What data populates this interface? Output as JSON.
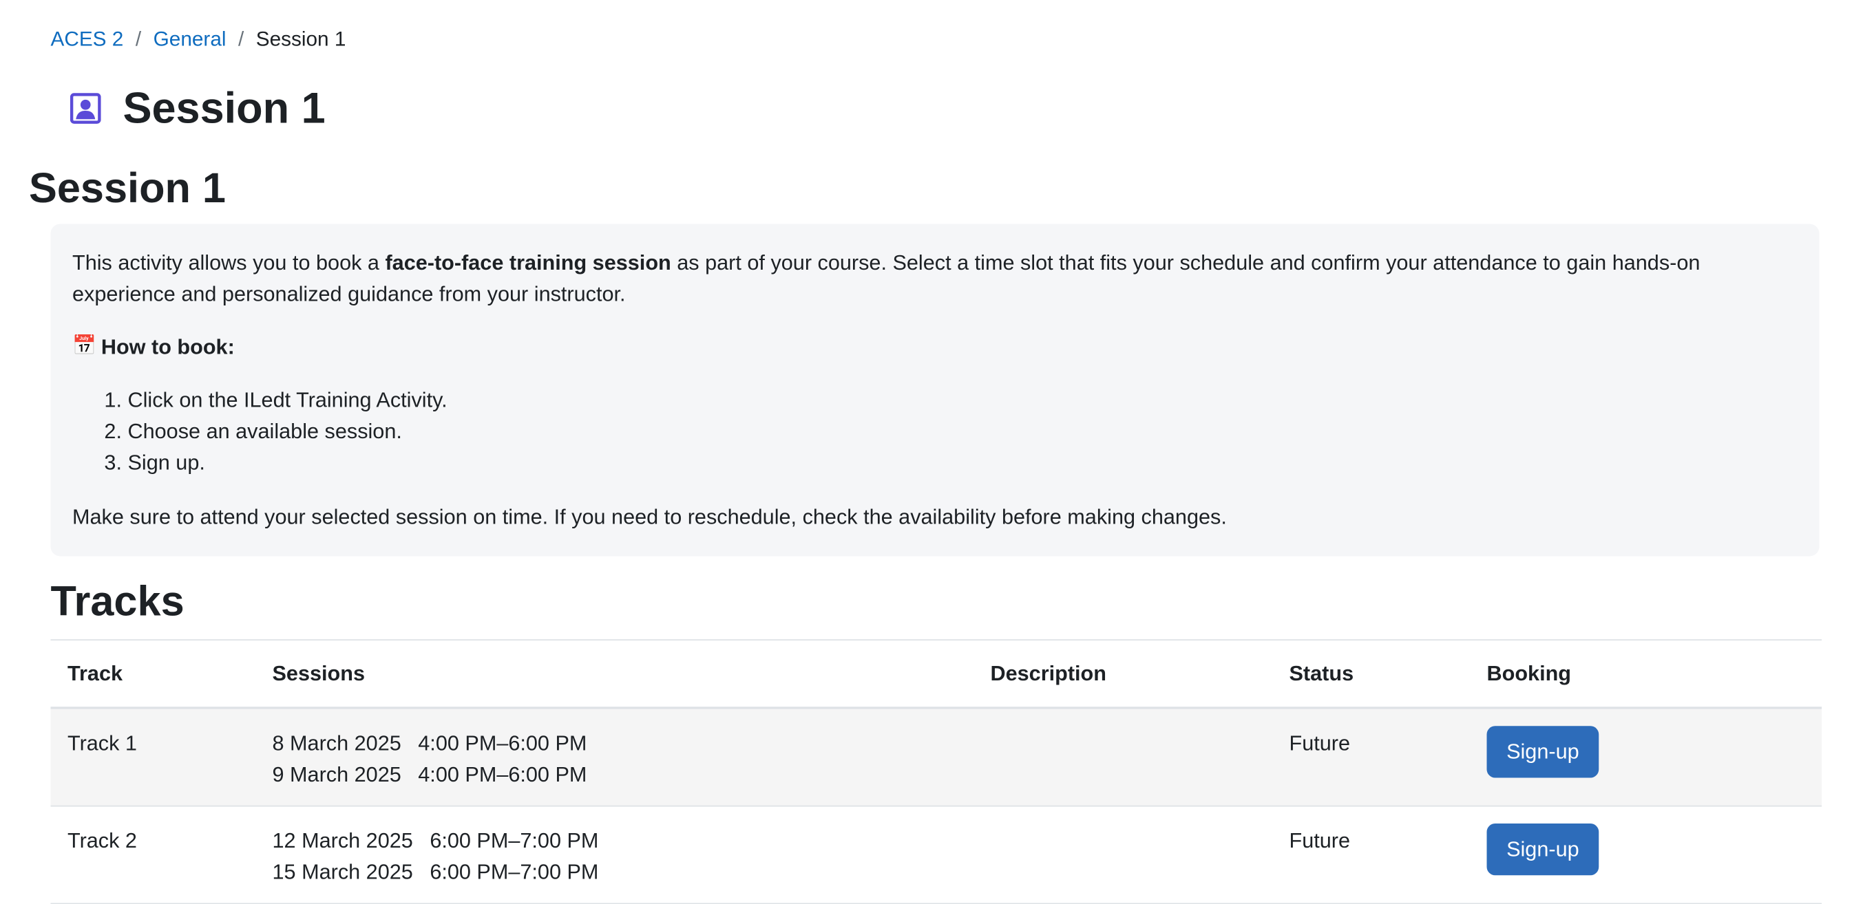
{
  "breadcrumb": {
    "items": [
      {
        "label": "ACES 2",
        "link": true
      },
      {
        "label": "General",
        "link": true
      },
      {
        "label": "Session 1",
        "link": false
      }
    ],
    "separator": "/"
  },
  "page_header": {
    "title": "Session 1",
    "icon": "user-portrait-icon",
    "icon_color": "#5b4bd8"
  },
  "activity": {
    "title": "Session 1",
    "intro_text_before_bold": "This activity allows you to book a ",
    "intro_bold": "face-to-face training session",
    "intro_text_after_bold": " as part of your course. Select a time slot that fits your schedule and confirm your attendance to gain hands-on experience and personalized guidance from your instructor.",
    "howto_icon": "📅",
    "howto_label": "How to book:",
    "steps": [
      "Click on the ILedt Training Activity.",
      "Choose an available session.",
      "Sign up."
    ],
    "closing_text": "Make sure to attend your selected session on time. If you need to reschedule, check the availability before making changes."
  },
  "tracks": {
    "heading": "Tracks",
    "columns": {
      "track": "Track",
      "sessions": "Sessions",
      "description": "Description",
      "status": "Status",
      "booking": "Booking"
    },
    "rows": [
      {
        "track": "Track 1",
        "sessions": [
          {
            "date": "8 March 2025",
            "time": "4:00 PM–6:00 PM"
          },
          {
            "date": "9 March 2025",
            "time": "4:00 PM–6:00 PM"
          }
        ],
        "description": "",
        "status": "Future",
        "booking_label": "Sign-up"
      },
      {
        "track": "Track 2",
        "sessions": [
          {
            "date": "12 March 2025",
            "time": "6:00 PM–7:00 PM"
          },
          {
            "date": "15 March 2025",
            "time": "6:00 PM–7:00 PM"
          }
        ],
        "description": "",
        "status": "Future",
        "booking_label": "Sign-up"
      }
    ]
  },
  "colors": {
    "link": "#0f6cbf",
    "button": "#2d6cba",
    "intro_background": "#f5f6f8",
    "striped_row": "#f5f5f5"
  }
}
